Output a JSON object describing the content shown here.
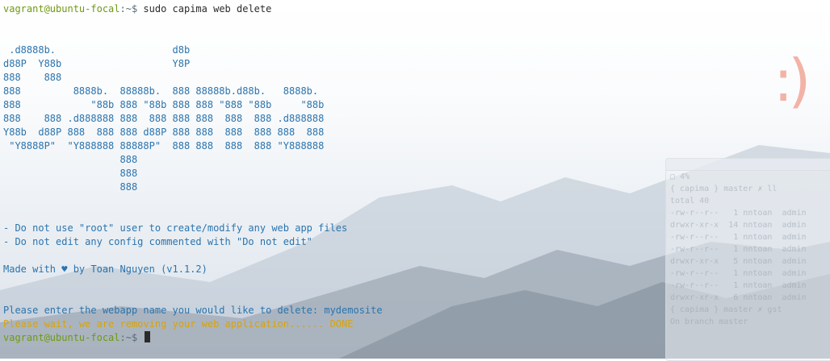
{
  "terminal": {
    "first_prompt": {
      "user_host": "vagrant@ubuntu-focal",
      "path_symbol": ":~$",
      "command": " sudo capima web delete"
    },
    "ascii_art": [
      "",
      "",
      " .d8888b.                    d8b",
      "d88P  Y88b                   Y8P",
      "888    888",
      "888         8888b.  88888b.  888 88888b.d88b.   8888b.",
      "888            \"88b 888 \"88b 888 888 \"888 \"88b     \"88b",
      "888    888 .d888888 888  888 888 888  888  888 .d888888",
      "Y88b  d88P 888  888 888 d88P 888 888  888  888 888  888",
      " \"Y8888P\"  \"Y888888 88888P\"  888 888  888  888 \"Y888888",
      "                    888",
      "                    888",
      "                    888",
      "",
      ""
    ],
    "notes": [
      "- Do not use \"root\" user to create/modify any web app files",
      "- Do not edit any config commented with \"Do not edit\""
    ],
    "made_with": "Made with ♥ by Toan Nguyen (v1.1.2)",
    "question": "Please enter the webapp name you would like to delete: mydemosite",
    "progress": "Please wait, we are removing your web application...... DONE",
    "last_prompt": {
      "user_host": "vagrant@ubuntu-focal",
      "path_symbol": ":~$"
    }
  },
  "wallpaper": {
    "smiley": ":)"
  },
  "background_window": {
    "cpu": "4%",
    "lines": [
      "{ capima } master ✗ ll",
      "total 40",
      "-rw-r--r--   1 nntoan  admin",
      "drwxr-xr-x  14 nntoan  admin",
      "-rw-r--r--   1 nntoan  admin",
      "-rw-r--r--   1 nntoan  admin",
      "drwxr-xr-x   5 nntoan  admin",
      "-rw-r--r--   1 nntoan  admin",
      "-rw-r--r--   1 nntoan  admin",
      "drwxr-xr-x   6 nntoan  admin",
      "{ capima } master ✗ gst",
      "On branch master"
    ]
  },
  "colors": {
    "prompt_user": "#6f9a11",
    "ascii": "#2b74ad",
    "warning": "#d8a30b"
  }
}
